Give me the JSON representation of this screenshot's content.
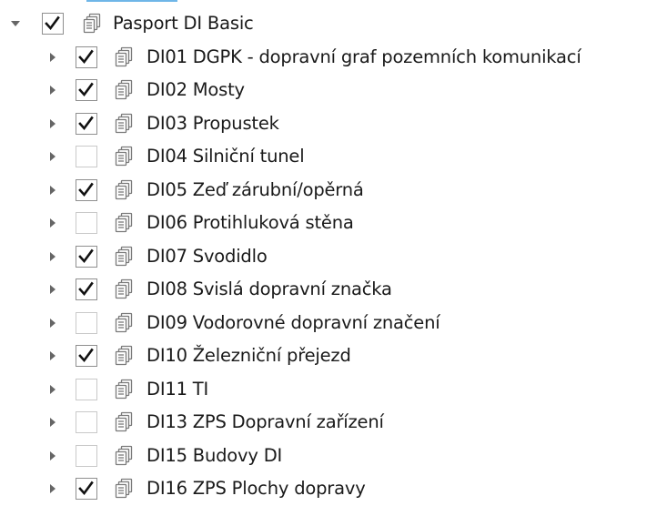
{
  "tree": {
    "root": {
      "label": "Pasport DI Basic",
      "checked": true,
      "expanded": true,
      "icon": "layer-group-icon"
    },
    "children": [
      {
        "label": "DI01 DGPK - dopravní graf pozemních komunikací",
        "checked": true
      },
      {
        "label": "DI02 Mosty",
        "checked": true
      },
      {
        "label": "DI03 Propustek",
        "checked": true
      },
      {
        "label": "DI04 Silniční tunel",
        "checked": false
      },
      {
        "label": "DI05 Zeď zárubní/opěrná",
        "checked": true
      },
      {
        "label": "DI06 Protihluková stěna",
        "checked": false
      },
      {
        "label": "DI07 Svodidlo",
        "checked": true
      },
      {
        "label": "DI08 Svislá dopravní značka",
        "checked": true
      },
      {
        "label": "DI09 Vodorovné dopravní značení",
        "checked": false
      },
      {
        "label": "DI10 Železniční přejezd",
        "checked": true
      },
      {
        "label": "DI11 TI",
        "checked": false
      },
      {
        "label": "DI13 ZPS Dopravní zařízení",
        "checked": false
      },
      {
        "label": "DI15 Budovy DI",
        "checked": false
      },
      {
        "label": "DI16 ZPS Plochy dopravy",
        "checked": true
      }
    ]
  },
  "colors": {
    "check": "#111111",
    "icon_stroke": "#7a7a7a",
    "selection_line": "#6fb6e8"
  }
}
